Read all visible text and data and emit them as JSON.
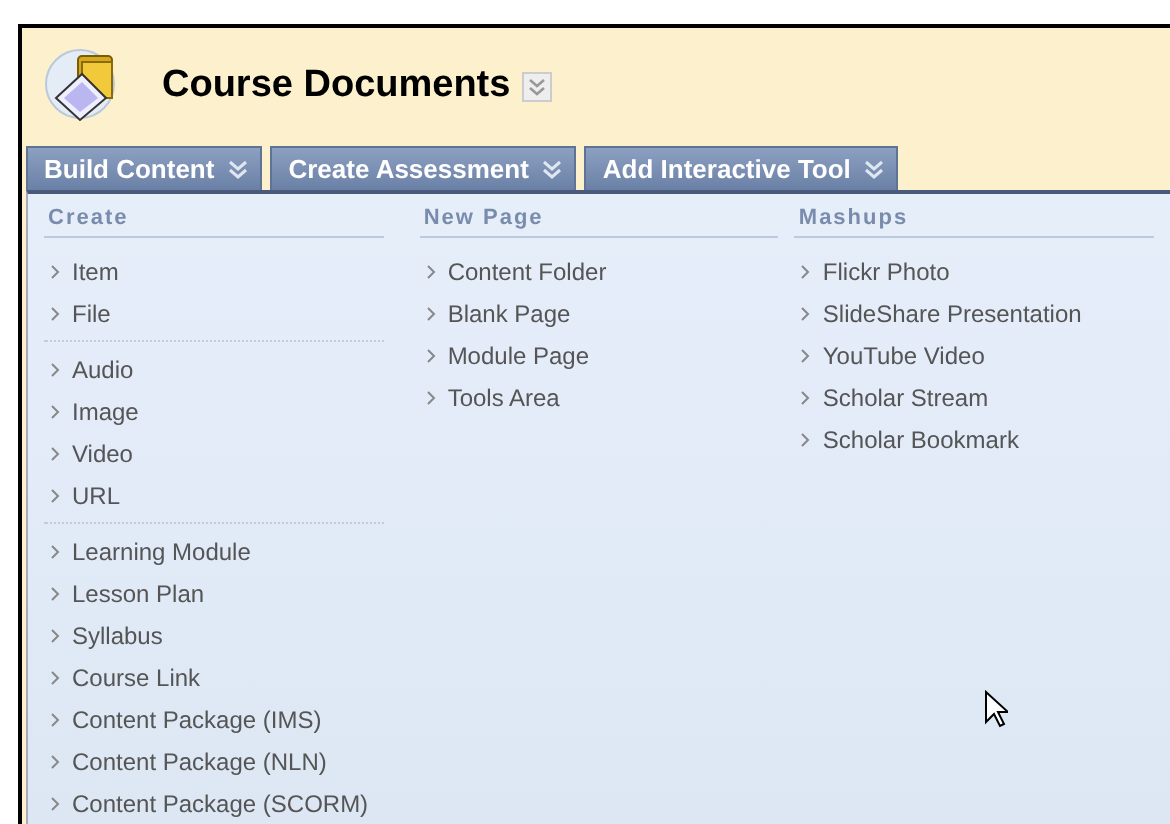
{
  "page": {
    "title": "Course Documents"
  },
  "tabs": [
    {
      "label": "Build Content"
    },
    {
      "label": "Create Assessment"
    },
    {
      "label": "Add Interactive Tool"
    }
  ],
  "menu": {
    "columns": [
      {
        "heading": "Create",
        "groups": [
          [
            "Item",
            "File"
          ],
          [
            "Audio",
            "Image",
            "Video",
            "URL"
          ],
          [
            "Learning Module",
            "Lesson Plan",
            "Syllabus",
            "Course Link",
            "Content Package (IMS)",
            "Content Package (NLN)",
            "Content Package (SCORM)"
          ]
        ]
      },
      {
        "heading": "New Page",
        "groups": [
          [
            "Content Folder",
            "Blank Page",
            "Module Page",
            "Tools Area"
          ]
        ]
      },
      {
        "heading": "Mashups",
        "groups": [
          [
            "Flickr Photo",
            "SlideShare Presentation",
            "YouTube Video",
            "Scholar Stream",
            "Scholar Bookmark"
          ]
        ]
      }
    ]
  }
}
